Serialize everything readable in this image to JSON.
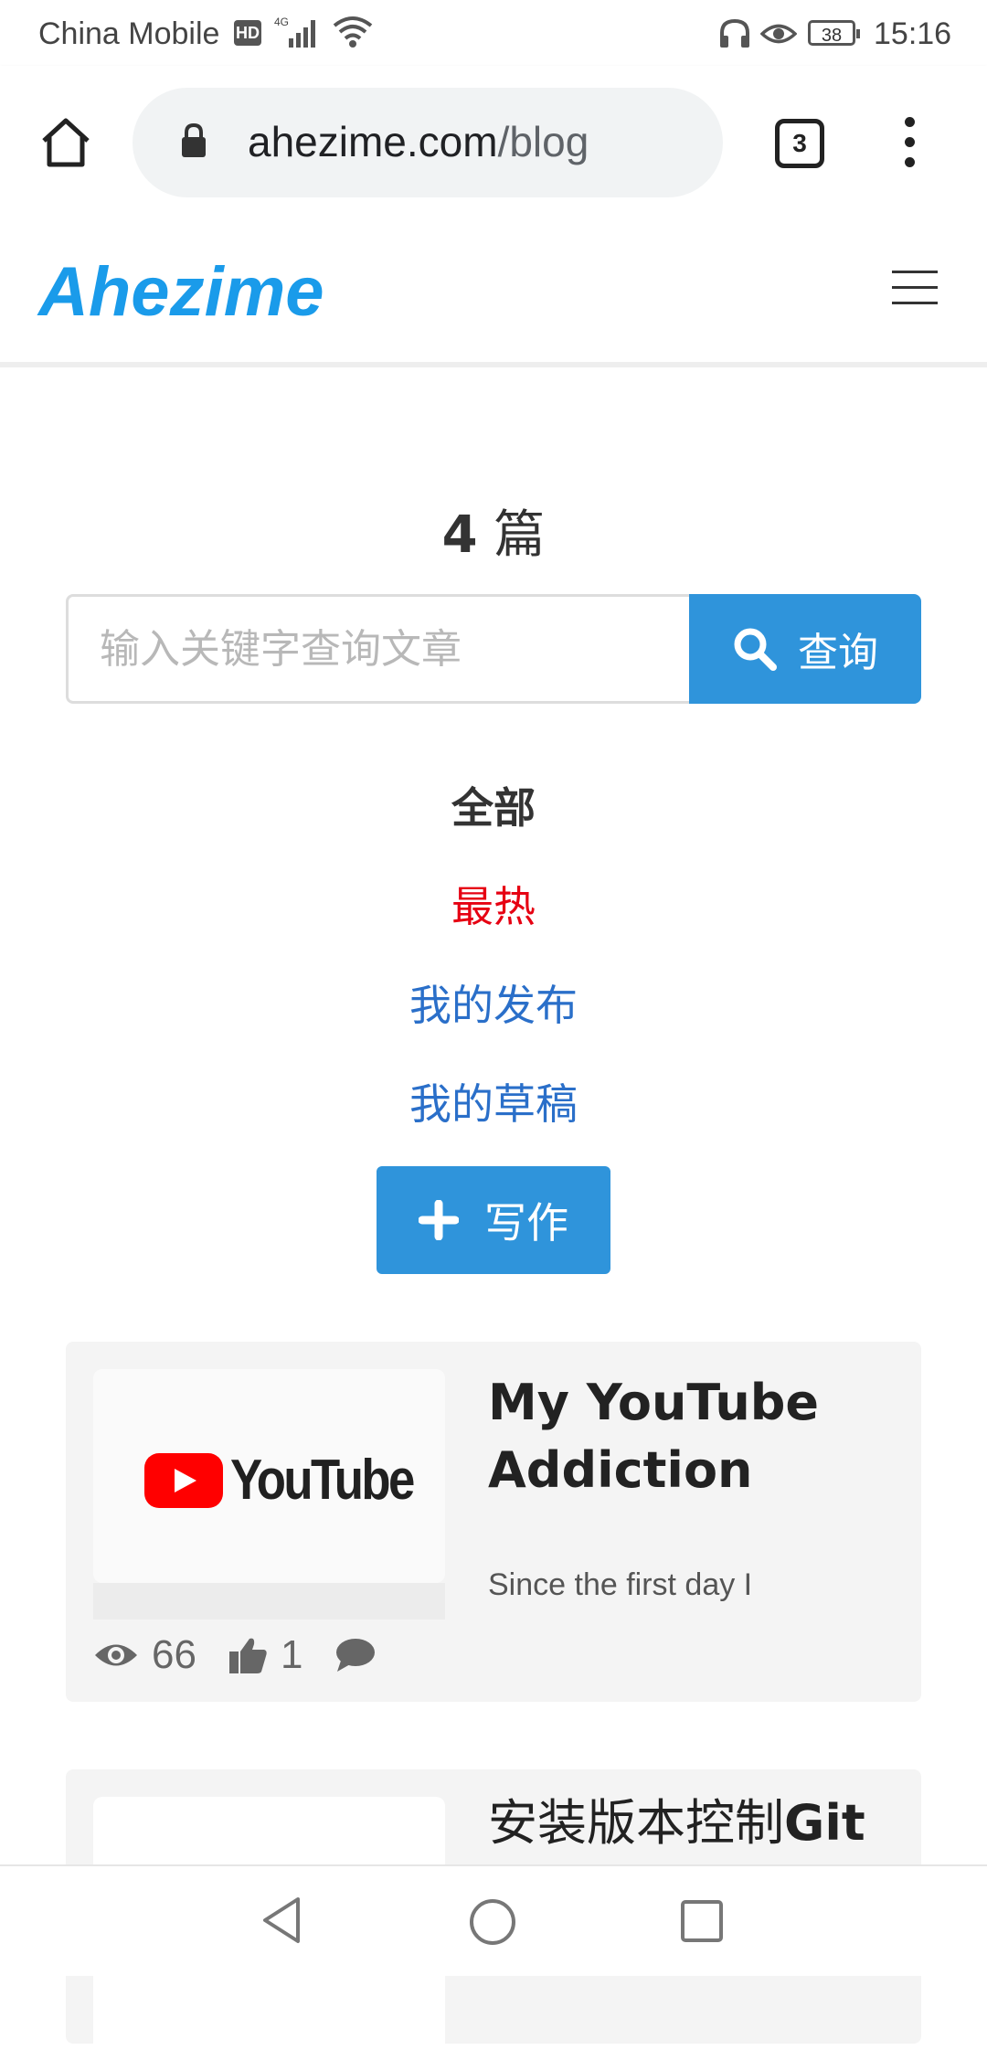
{
  "status_bar": {
    "carrier": "China Mobile",
    "hd_badge": "HD",
    "network": "4G",
    "battery": "38",
    "time": "15:16"
  },
  "browser": {
    "url_domain": "ahezime.com",
    "url_path": "/blog",
    "tab_count": "3"
  },
  "site": {
    "logo": "Ahezime"
  },
  "main": {
    "count_number": "4",
    "count_unit": "篇",
    "search_placeholder": "输入关键字查询文章",
    "search_button": "查询",
    "filters": {
      "all": "全部",
      "hot": "最热",
      "my_published": "我的发布",
      "my_drafts": "我的草稿"
    },
    "write_button": "写作"
  },
  "posts": [
    {
      "thumbnail_text": "YouTube",
      "title": "My YouTube Addiction",
      "excerpt": "Since the first day I",
      "views": "66",
      "likes": "1"
    },
    {
      "title_prefix": "安装版本控制",
      "title_suffix": "Git"
    }
  ],
  "colors": {
    "brand": "#1a9bea",
    "primary_button": "#2f94db",
    "hot_filter": "#e60012",
    "link": "#2a6fc9"
  }
}
